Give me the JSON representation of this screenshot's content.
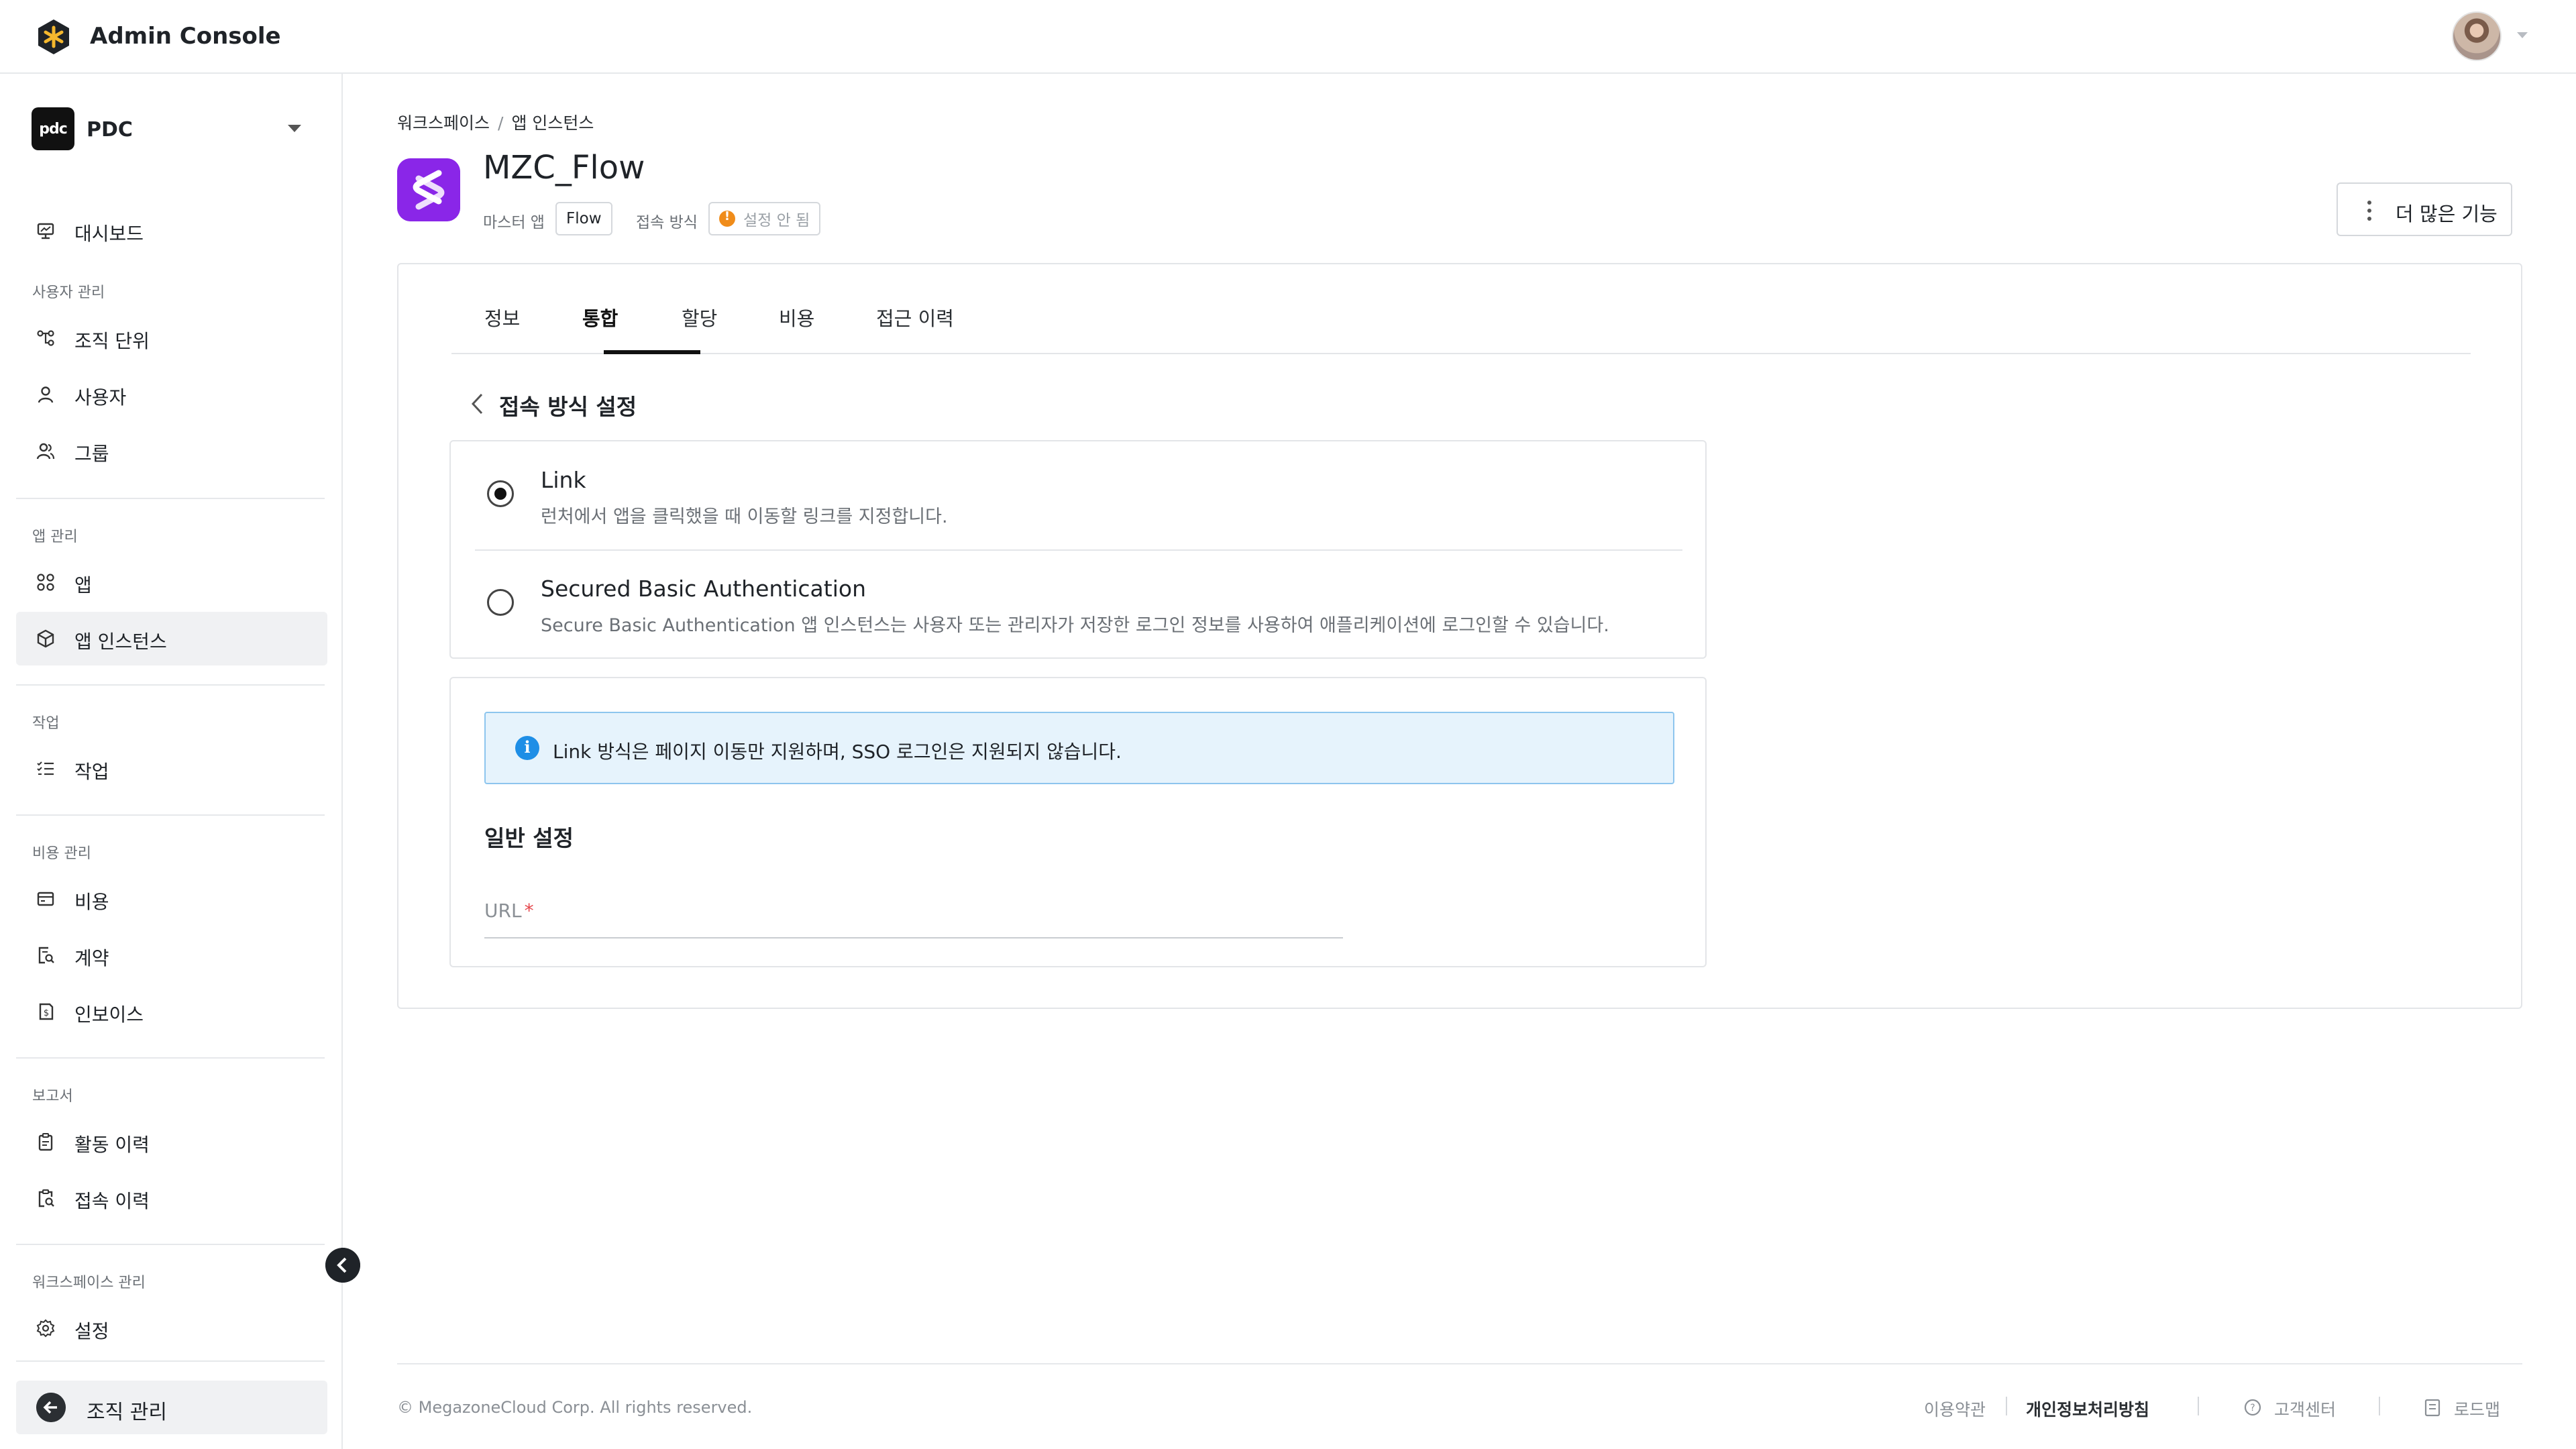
{
  "header": {
    "title": "Admin Console"
  },
  "sidebar": {
    "org_logo_text": "pdc",
    "org_name": "PDC",
    "dashboard": "대시보드",
    "sections": {
      "users": "사용자 관리",
      "apps": "앱 관리",
      "tasks": "작업",
      "costs": "비용 관리",
      "reports": "보고서",
      "workspace": "워크스페이스 관리"
    },
    "items": {
      "org_unit": "조직 단위",
      "user": "사용자",
      "group": "그룹",
      "app": "앱",
      "app_instance": "앱 인스턴스",
      "task": "작업",
      "cost": "비용",
      "contract": "계약",
      "invoice": "인보이스",
      "activity_history": "활동 이력",
      "access_history": "접속 이력",
      "settings": "설정"
    },
    "org_manage": "조직 관리"
  },
  "breadcrumb": {
    "workspace": "워크스페이스",
    "separator": "/",
    "current": "앱 인스턴스"
  },
  "page": {
    "title": "MZC_Flow",
    "master_app_label": "마스터 앱",
    "master_app_value": "Flow",
    "access_method_label": "접속 방식",
    "access_method_value": "설정 안 됨",
    "more_button": "더 많은 기능"
  },
  "tabs": [
    "정보",
    "통합",
    "할당",
    "비용",
    "접근 이력"
  ],
  "active_tab": "통합",
  "access_settings": {
    "title": "접속 방식 설정",
    "options": [
      {
        "title": "Link",
        "description": "런처에서 앱을 클릭했을 때 이동할 링크를 지정합니다.",
        "selected": true
      },
      {
        "title": "Secured Basic Authentication",
        "description": "Secure Basic Authentication 앱 인스턴스는 사용자 또는 관리자가 저장한 로그인 정보를 사용하여 애플리케이션에 로그인할 수 있습니다.",
        "selected": false
      }
    ],
    "info": "Link 방식은 페이지 이동만 지원하며, SSO 로그인은 지원되지 않습니다.",
    "general_title": "일반 설정",
    "url_label": "URL",
    "url_required_mark": "*",
    "url_value": ""
  },
  "footer": {
    "copyright": "© MegazoneCloud Corp. All rights reserved.",
    "terms": "이용약관",
    "privacy": "개인정보처리방침",
    "support": "고객센터",
    "roadmap": "로드맵"
  },
  "colors": {
    "app_icon": "#8a26e8",
    "warning": "#f08c1a",
    "info_bg": "#e6f3fc",
    "info_icon": "#1e8ee6",
    "required": "#e5484d"
  }
}
